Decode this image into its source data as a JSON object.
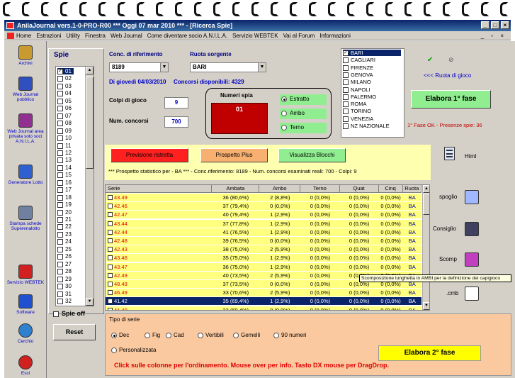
{
  "window": {
    "title": "AnilaJournal vers.1-0-PRO-R00  ***  Oggi 07 mar 2010  ***  - [Ricerca Spie]"
  },
  "menu": [
    "Home",
    "Estrazioni",
    "Utility",
    "Finestra",
    "Web Journal",
    "Come diventare socio A.N.I.L.A.",
    "Servizio WEBTEK",
    "Vai al Forum",
    "Informazioni"
  ],
  "toolbar": [
    {
      "icon": "pencil-icon",
      "label": "Archivi"
    },
    {
      "icon": "journal-icon",
      "label": "Web Journal pubblico"
    },
    {
      "icon": "book-icon",
      "label": "Web Journal area privata solo soci A.N.I.L.A."
    },
    {
      "icon": "generator-icon",
      "label": "Generatore Lotto"
    },
    {
      "icon": "printer-icon",
      "label": "Stampa schede Superenalotto"
    },
    {
      "icon": "webtek-icon",
      "label": "Servizio WEBTEK"
    },
    {
      "icon": "software-icon",
      "label": "Software"
    },
    {
      "icon": "circle-icon",
      "label": "Cerchio"
    },
    {
      "icon": "exit-icon",
      "label": "Esci"
    }
  ],
  "spie": {
    "title": "Spie",
    "items": [
      "01",
      "02",
      "03",
      "04",
      "05",
      "06",
      "07",
      "08",
      "09",
      "10",
      "11",
      "12",
      "13",
      "14",
      "15",
      "16",
      "17",
      "18",
      "19",
      "20",
      "21",
      "22",
      "23",
      "24",
      "25",
      "26",
      "27",
      "28",
      "29",
      "30",
      "31",
      "32"
    ],
    "selected": "01",
    "spie_off": "Spie off",
    "reset": "Reset"
  },
  "form": {
    "conc_label": "Conc. di riferimento",
    "conc_value": "8189",
    "ruota_label": "Ruota sorgente",
    "ruota_value": "BARI",
    "date_text": "Di  giovedì 04/03/2010",
    "concorsi_text": "Concorsi disponibili: 4329",
    "colpi_label": "Colpi di gioco",
    "colpi_value": "9",
    "num_label": "Num. concorsi",
    "num_value": "700",
    "numeri_spia_label": "Numeri spia",
    "numeri_spia_value": "01",
    "radio": [
      "Estratto",
      "Ambo",
      "Terno"
    ],
    "radio_selected": "Estratto"
  },
  "ruote": {
    "items": [
      "BARI",
      "CAGLIARI",
      "FIRENZE",
      "GENOVA",
      "MILANO",
      "NAPOLI",
      "PALERMO",
      "ROMA",
      "TORINO",
      "VENEZIA",
      "NZ NAZIONALE"
    ],
    "checked": "BARI",
    "check": "✔",
    "nocheck": "⊘",
    "ruota_gioco": "<<< Ruota di gioco",
    "elabora1": "Elabora 1° fase",
    "status": "1° Fase OK - Presenze spie: 36"
  },
  "buttons": {
    "previsione": "Previsione ristretta",
    "prospetto": "Prospetto Plus",
    "visualizza": "Visualizza Blocchi",
    "html": "Html"
  },
  "prospetto_text": "*** Prospetto statistico per  - BA ***  - Conc.riferimento:  8189 - Num. concorsi esaminati reali: 700 - Colpi: 9",
  "grid": {
    "headers": [
      "Serie",
      "Ambata",
      "Ambo",
      "Terno",
      "Quat",
      "Cinq",
      "Ruota"
    ],
    "rows": [
      [
        "43.49",
        "36 (80,6%)",
        "2 (8,8%)",
        "0 (0,0%)",
        "0 (0,0%)",
        "0 (0,0%)",
        "BA"
      ],
      [
        "42.46",
        "37 (79,4%)",
        "0 (0,0%)",
        "0 (0,0%)",
        "0 (0,0%)",
        "0 (0,0%)",
        "BA"
      ],
      [
        "42.47",
        "40 (79,4%)",
        "1 (2,9%)",
        "0 (0,0%)",
        "0 (0,0%)",
        "0 (0,0%)",
        "BA"
      ],
      [
        "43.44",
        "37 (77,8%)",
        "1 (2,9%)",
        "0 (0,0%)",
        "0 (0,0%)",
        "0 (0,0%)",
        "BA"
      ],
      [
        "42.44",
        "41 (76,5%)",
        "1 (2,9%)",
        "0 (0,0%)",
        "0 (0,0%)",
        "0 (0,0%)",
        "BA"
      ],
      [
        "42.48",
        "39 (76,5%)",
        "0 (0,0%)",
        "0 (0,0%)",
        "0 (0,0%)",
        "0 (0,0%)",
        "BA"
      ],
      [
        "42.43",
        "38 (75,0%)",
        "2 (5,9%)",
        "0 (0,0%)",
        "0 (0,0%)",
        "0 (0,0%)",
        "BA"
      ],
      [
        "43.46",
        "35 (75,0%)",
        "1 (2,9%)",
        "0 (0,0%)",
        "0 (0,0%)",
        "0 (0,0%)",
        "BA"
      ],
      [
        "43.47",
        "36 (75,0%)",
        "1 (2,9%)",
        "0 (0,0%)",
        "0 (0,0%)",
        "0 (0,0%)",
        "BA"
      ],
      [
        "42.49",
        "40 (73,5%)",
        "2 (5,9%)",
        "0 (0,0%)",
        "0 (0,0%)",
        "0 (0,0%)",
        "BA"
      ],
      [
        "48.49",
        "37 (73,5%)",
        "0 (0,0%)",
        "0 (0,0%)",
        "0 (0,0%)",
        "0 (0,0%)",
        "BA"
      ],
      [
        "46.49",
        "33 (70,6%)",
        "2 (5,9%)",
        "0 (0,0%)",
        "0 (0,0%)",
        "0 (0,0%)",
        "BA"
      ],
      [
        "41.42",
        "35 (69,4%)",
        "1 (2,9%)",
        "0 (0,0%)",
        "0 (0,0%)",
        "0 (0,0%)",
        "BA"
      ],
      [
        "41.49",
        "33 (69,4%)",
        "0 (0,0%)",
        "0 (0,0%)",
        "0 (0,0%)",
        "0 (0,0%)",
        "BA"
      ]
    ],
    "selected_index": 12
  },
  "right_tools": [
    {
      "icon": "spoglio-icon",
      "label": "spoglio"
    },
    {
      "icon": "consiglio-icon",
      "label": "Consiglio"
    },
    {
      "icon": "scomp-icon",
      "label": "Scomp"
    },
    {
      "icon": "cmb-icon",
      "label": ".cmb"
    }
  ],
  "tooltip": "Scomposizione lunghetta in AMBI per la definizione dei capigioco",
  "tipo": {
    "title": "Tipo di serie",
    "options": [
      "Dec",
      "Fig",
      "Cad",
      "Vertibili",
      "Gemelli",
      "90 numeri",
      "Personalizzata"
    ],
    "selected": "Dec",
    "elabora2": "Elabora  2° fase",
    "hint": "Click sulle colonne per l'ordinamento. Mouse over per info. Tasto DX mouse per DragDrop."
  },
  "colors": {
    "title_bar": "#0a246a",
    "red_box": "#c00000",
    "yellow": "#ffff80",
    "green": "#90ee90",
    "orange": "#f8c080"
  }
}
